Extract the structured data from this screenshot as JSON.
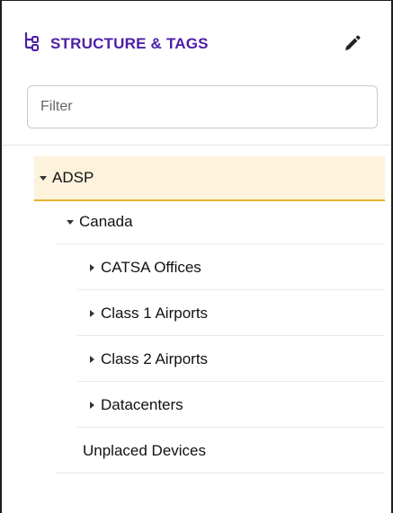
{
  "header": {
    "icon": "structure-icon",
    "title": "STRUCTURE & TAGS",
    "edit_icon": "pencil-icon"
  },
  "filter": {
    "placeholder": "Filter",
    "value": ""
  },
  "tree": {
    "root": {
      "label": "ADSP",
      "expanded": true,
      "selected": true
    },
    "country": {
      "label": "Canada",
      "expanded": true
    },
    "children": [
      {
        "label": "CATSA Offices",
        "expanded": false
      },
      {
        "label": "Class 1 Airports",
        "expanded": false
      },
      {
        "label": "Class 2 Airports",
        "expanded": false
      },
      {
        "label": "Datacenters",
        "expanded": false
      }
    ],
    "unplaced": {
      "label": "Unplaced Devices"
    }
  },
  "colors": {
    "accent": "#4b1fa8",
    "selected_bg": "#fdf3dd",
    "selected_border": "#e7b32e"
  }
}
